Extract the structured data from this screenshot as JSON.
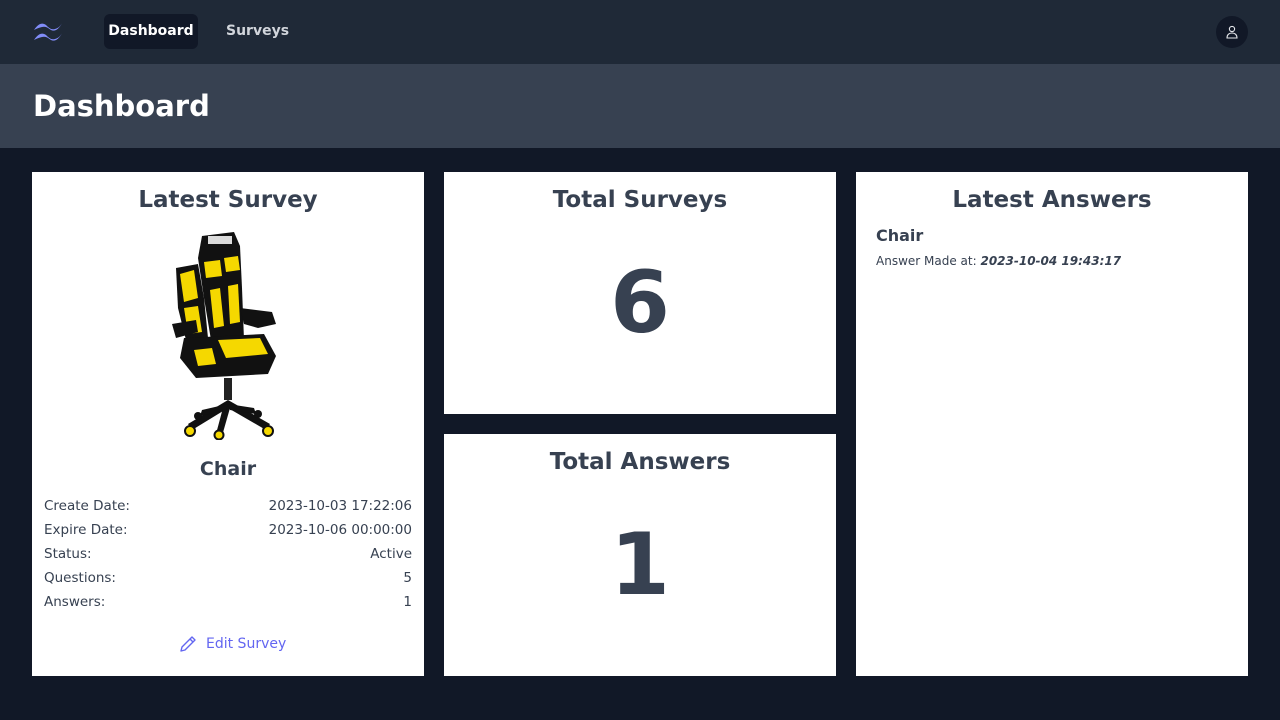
{
  "nav": {
    "items": [
      {
        "label": "Dashboard",
        "active": true
      },
      {
        "label": "Surveys",
        "active": false
      }
    ],
    "accent": "#6366f1"
  },
  "header": {
    "title": "Dashboard"
  },
  "latest_survey": {
    "title": "Latest Survey",
    "name": "Chair",
    "fields": [
      {
        "label": "Create Date:",
        "value": "2023-10-03 17:22:06"
      },
      {
        "label": "Expire Date:",
        "value": "2023-10-06 00:00:00"
      },
      {
        "label": "Status:",
        "value": "Active"
      },
      {
        "label": "Questions:",
        "value": "5"
      },
      {
        "label": "Answers:",
        "value": "1"
      }
    ],
    "edit_label": "Edit Survey",
    "image_icon": "gaming-chair-image"
  },
  "total_surveys": {
    "title": "Total Surveys",
    "value": "6"
  },
  "total_answers": {
    "title": "Total Answers",
    "value": "1"
  },
  "latest_answers": {
    "title": "Latest Answers",
    "items": [
      {
        "survey": "Chair",
        "made_at_label": "Answer Made at:",
        "made_at": "2023-10-04 19:43:17"
      }
    ]
  }
}
